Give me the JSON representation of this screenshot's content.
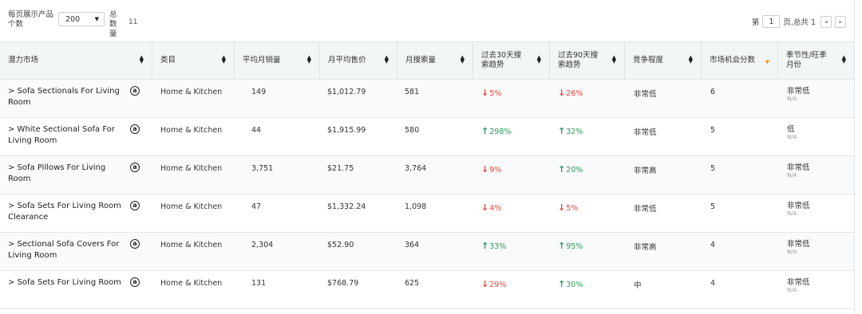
{
  "toolbar": {
    "per_page_label": "每页展示产品个数",
    "per_page_value": "200",
    "total_label": "总数量",
    "total_value": "11",
    "page_prefix": "第",
    "page_value": "1",
    "page_suffix": "页,总共 1",
    "prev_icon": "◂",
    "next_icon": "▸"
  },
  "table": {
    "headers": [
      "潜力市场",
      "类目",
      "平均月销量",
      "月平均售价",
      "月搜索量",
      "过去30天搜索趋势",
      "过去90天搜索趋势",
      "竞争程度",
      "市场机会分数",
      "季节性/旺季月份"
    ],
    "rows": [
      {
        "name": "> Sofa Sectionals For Living Room",
        "category": "Home & Kitchen",
        "sales": "149",
        "price": "$1,012.79",
        "search": "581",
        "t30_dir": "down",
        "t30": "5%",
        "t90_dir": "down",
        "t90": "26%",
        "competition": "非常低",
        "score": "6",
        "season": "非常低",
        "season_sub": "N/A"
      },
      {
        "name": "> White Sectional Sofa For Living Room",
        "category": "Home & Kitchen",
        "sales": "44",
        "price": "$1,915.99",
        "search": "580",
        "t30_dir": "up",
        "t30": "298%",
        "t90_dir": "up",
        "t90": "32%",
        "competition": "非常低",
        "score": "5",
        "season": "低",
        "season_sub": "N/A"
      },
      {
        "name": "> Sofa Pillows For Living Room",
        "category": "Home & Kitchen",
        "sales": "3,751",
        "price": "$21.75",
        "search": "3,764",
        "t30_dir": "down",
        "t30": "9%",
        "t90_dir": "up",
        "t90": "20%",
        "competition": "非常高",
        "score": "5",
        "season": "非常低",
        "season_sub": "N/A"
      },
      {
        "name": "> Sofa Sets For Living Room Clearance",
        "category": "Home & Kitchen",
        "sales": "47",
        "price": "$1,332.24",
        "search": "1,098",
        "t30_dir": "down",
        "t30": "4%",
        "t90_dir": "down",
        "t90": "5%",
        "competition": "非常低",
        "score": "5",
        "season": "非常低",
        "season_sub": "N/A"
      },
      {
        "name": "> Sectional Sofa Covers For Living Room",
        "category": "Home & Kitchen",
        "sales": "2,304",
        "price": "$52.90",
        "search": "364",
        "t30_dir": "up",
        "t30": "33%",
        "t90_dir": "up",
        "t90": "95%",
        "competition": "非常高",
        "score": "4",
        "season": "非常低",
        "season_sub": "N/A"
      },
      {
        "name": "> Sofa Sets For Living Room",
        "category": "Home & Kitchen",
        "sales": "131",
        "price": "$768.79",
        "search": "625",
        "t30_dir": "down",
        "t30": "29%",
        "t90_dir": "up",
        "t90": "30%",
        "competition": "中",
        "score": "4",
        "season": "非常低",
        "season_sub": "N/A"
      }
    ]
  },
  "icons": {
    "amazon": "amazon-icon",
    "down": "arrow-down-icon",
    "up": "arrow-up-icon",
    "sort": "sort-icon"
  },
  "colors": {
    "down": "#e0473e",
    "up": "#2e9a5a",
    "sort_active": "#f0932b",
    "header_bg": "#f3f6f7"
  }
}
